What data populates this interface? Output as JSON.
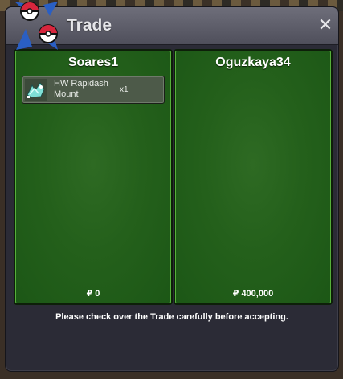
{
  "window": {
    "title": "Trade",
    "close_icon": "close-icon"
  },
  "left_party": {
    "name": "Soares1",
    "money_symbol": "₽",
    "money": "0",
    "items": [
      {
        "name": "HW Rapidash Mount",
        "qty": "x1",
        "icon": "rapidash-mount-icon"
      }
    ]
  },
  "right_party": {
    "name": "Oguzkaya34",
    "money_symbol": "₽",
    "money": "400,000"
  },
  "footer": {
    "note": "Please check over the Trade carefully before accepting."
  },
  "colors": {
    "panel_green": "#24601b",
    "title_bar": "#5e5e6a",
    "window_bg": "#2b2b36"
  }
}
